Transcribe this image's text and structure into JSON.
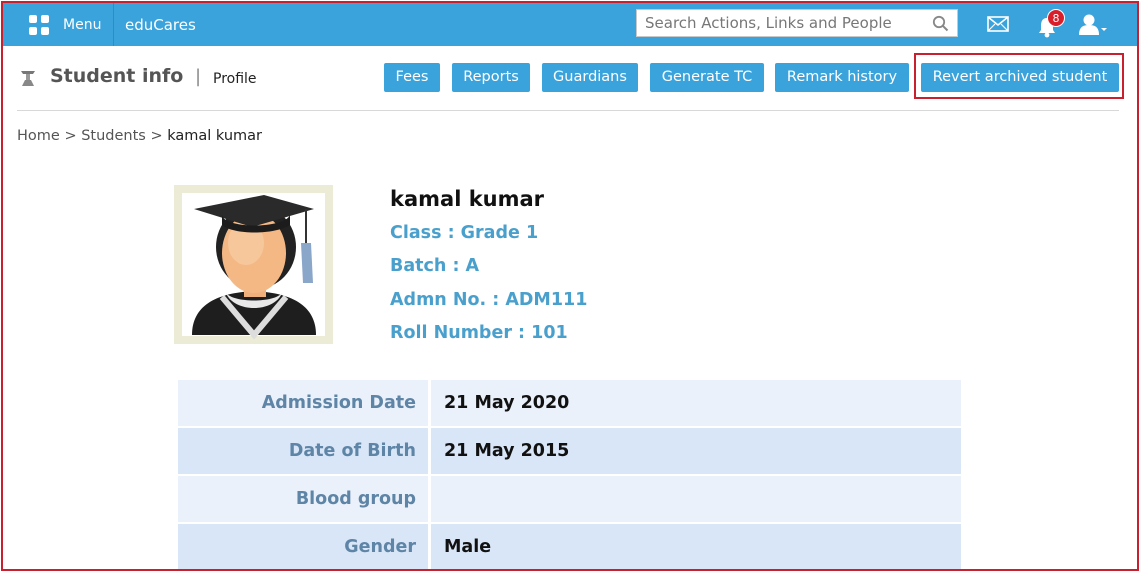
{
  "topbar": {
    "menu_label": "Menu",
    "brand": "eduCares",
    "search_placeholder": "Search Actions, Links and People",
    "notification_count": "8",
    "bar_color": "#3aa3dc"
  },
  "header": {
    "title": "Student info",
    "subtitle": "Profile",
    "buttons": [
      "Fees",
      "Reports",
      "Guardians",
      "Generate TC",
      "Remark history",
      "Revert archived student"
    ]
  },
  "breadcrumb": {
    "home": "Home",
    "students": "Students",
    "current": "kamal kumar",
    "separator": ">"
  },
  "profile": {
    "name": "kamal kumar",
    "class": "Class : Grade 1",
    "batch": "Batch : A",
    "admission_no": "Admn No. : ADM111",
    "roll_number": "Roll Number : 101"
  },
  "details": [
    {
      "label": "Admission Date",
      "value": "21 May 2020"
    },
    {
      "label": "Date of Birth",
      "value": "21 May 2015"
    },
    {
      "label": "Blood group",
      "value": ""
    },
    {
      "label": "Gender",
      "value": "Male"
    }
  ],
  "icons": {
    "menu": "grid-icon",
    "search": "search-icon",
    "mail": "mail-icon",
    "bell": "bell-icon",
    "user": "user-icon",
    "page": "graduation-icon"
  }
}
